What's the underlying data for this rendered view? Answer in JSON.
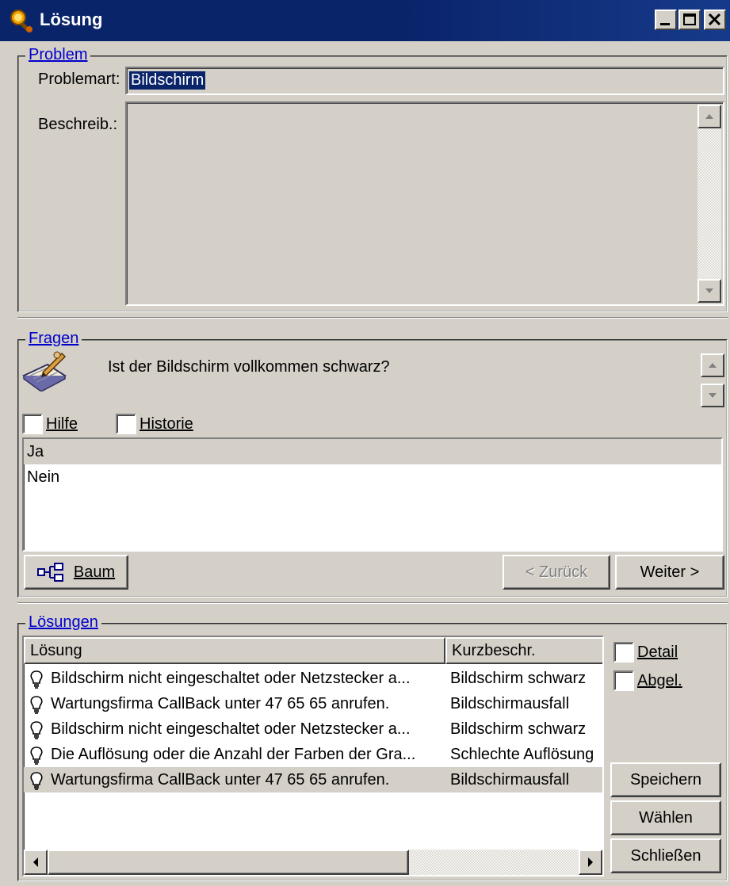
{
  "window": {
    "title": "Lösung"
  },
  "problem": {
    "legend": "Problem",
    "type_label": "Problemart:",
    "type_value": "Bildschirm",
    "desc_label": "Beschreib.:",
    "desc_value": ""
  },
  "questions": {
    "legend": "Fragen",
    "question": "Ist der Bildschirm vollkommen schwarz?",
    "help_label": "Hilfe",
    "history_label": "Historie",
    "answers": [
      "Ja",
      "Nein"
    ],
    "tree_button": "Baum",
    "back_button": "< Zurück",
    "next_button": "Weiter >"
  },
  "solutions": {
    "legend": "Lösungen",
    "columns": [
      "Lösung",
      "Kurzbeschr."
    ],
    "rows": [
      {
        "solution": "Bildschirm nicht eingeschaltet oder Netzstecker a...",
        "short": "Bildschirm schwarz"
      },
      {
        "solution": "Wartungsfirma CallBack unter 47 65 65 anrufen.",
        "short": "Bildschirmausfall"
      },
      {
        "solution": "Bildschirm nicht eingeschaltet oder Netzstecker a...",
        "short": "Bildschirm schwarz"
      },
      {
        "solution": "Die Auflösung oder die Anzahl der Farben der Gra...",
        "short": "Schlechte Auflösung"
      },
      {
        "solution": "Wartungsfirma CallBack unter 47 65 65 anrufen.",
        "short": "Bildschirmausfall"
      }
    ],
    "detail_label": "Detail",
    "done_label": "Abgel.",
    "save_button": "Speichern",
    "choose_button": "Wählen",
    "close_button": "Schließen"
  }
}
